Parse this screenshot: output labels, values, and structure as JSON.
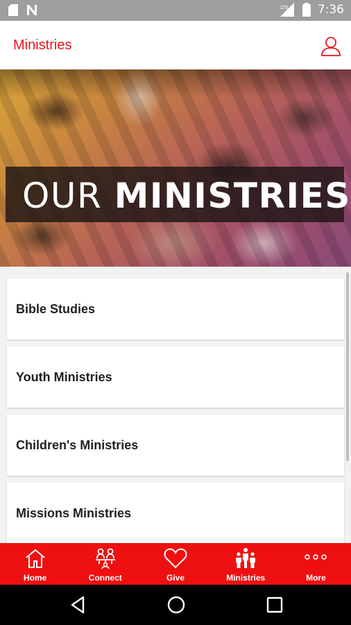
{
  "status_bar": {
    "time": "7:36",
    "network_label": "LTE",
    "icons": [
      "sd-card-icon",
      "n-notification-icon",
      "signal-icon",
      "battery-icon"
    ]
  },
  "app_bar": {
    "title": "Ministries",
    "user_icon": "user-icon"
  },
  "hero": {
    "heading_light": "OUR ",
    "heading_bold": "MINISTRIES"
  },
  "ministries": [
    {
      "label": "Bible Studies"
    },
    {
      "label": "Youth Ministries"
    },
    {
      "label": "Children's Ministries"
    },
    {
      "label": "Missions Ministries"
    }
  ],
  "bottom_nav": {
    "items": [
      {
        "label": "Home",
        "icon": "home-icon"
      },
      {
        "label": "Connect",
        "icon": "connect-icon"
      },
      {
        "label": "Give",
        "icon": "heart-icon"
      },
      {
        "label": "Ministries",
        "icon": "people-icon"
      },
      {
        "label": "More",
        "icon": "more-icon"
      }
    ]
  },
  "system_nav": {
    "icons": [
      "back-icon",
      "home-circle-icon",
      "recents-icon"
    ]
  },
  "colors": {
    "accent": "#e8141b",
    "nav_background": "#ee1010",
    "status_bar": "#9e9e9e"
  }
}
